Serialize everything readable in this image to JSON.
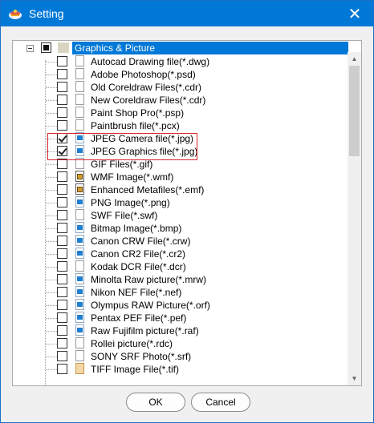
{
  "window": {
    "title": "Setting",
    "close_glyph": "✕"
  },
  "tree": {
    "root_label": "Graphics & Picture",
    "root_checked": "partial",
    "items": [
      {
        "label": "Autocad Drawing file(*.dwg)",
        "checked": false,
        "icon": "document-icon"
      },
      {
        "label": "Adobe Photoshop(*.psd)",
        "checked": false,
        "icon": "document-icon"
      },
      {
        "label": "Old Coreldraw Files(*.cdr)",
        "checked": false,
        "icon": "document-icon"
      },
      {
        "label": "New Coreldraw Files(*.cdr)",
        "checked": false,
        "icon": "document-icon"
      },
      {
        "label": "Paint Shop Pro(*.psp)",
        "checked": false,
        "icon": "document-icon"
      },
      {
        "label": "Paintbrush file(*.pcx)",
        "checked": false,
        "icon": "document-icon"
      },
      {
        "label": "JPEG Camera file(*.jpg)",
        "checked": true,
        "icon": "image-file-icon"
      },
      {
        "label": "JPEG Graphics file(*.jpg)",
        "checked": true,
        "icon": "image-file-icon"
      },
      {
        "label": "GIF Files(*.gif)",
        "checked": false,
        "icon": "document-icon"
      },
      {
        "label": "WMF Image(*.wmf)",
        "checked": false,
        "icon": "metafile-icon"
      },
      {
        "label": "Enhanced Metafiles(*.emf)",
        "checked": false,
        "icon": "metafile-icon"
      },
      {
        "label": "PNG Image(*.png)",
        "checked": false,
        "icon": "image-file-icon"
      },
      {
        "label": "SWF File(*.swf)",
        "checked": false,
        "icon": "document-icon"
      },
      {
        "label": "Bitmap Image(*.bmp)",
        "checked": false,
        "icon": "image-file-icon"
      },
      {
        "label": "Canon CRW File(*.crw)",
        "checked": false,
        "icon": "image-file-icon"
      },
      {
        "label": "Canon CR2 File(*.cr2)",
        "checked": false,
        "icon": "image-file-icon"
      },
      {
        "label": "Kodak DCR File(*.dcr)",
        "checked": false,
        "icon": "document-icon"
      },
      {
        "label": "Minolta Raw picture(*.mrw)",
        "checked": false,
        "icon": "image-file-icon"
      },
      {
        "label": "Nikon NEF File(*.nef)",
        "checked": false,
        "icon": "image-file-icon"
      },
      {
        "label": "Olympus RAW Picture(*.orf)",
        "checked": false,
        "icon": "image-file-icon"
      },
      {
        "label": "Pentax PEF File(*.pef)",
        "checked": false,
        "icon": "image-file-icon"
      },
      {
        "label": "Raw Fujifilm picture(*.raf)",
        "checked": false,
        "icon": "image-file-icon"
      },
      {
        "label": "Rollei picture(*.rdc)",
        "checked": false,
        "icon": "document-icon"
      },
      {
        "label": "SONY SRF Photo(*.srf)",
        "checked": false,
        "icon": "document-icon"
      },
      {
        "label": "TIFF Image File(*.tif)",
        "checked": false,
        "icon": "tiff-file-icon"
      }
    ]
  },
  "buttons": {
    "ok": "OK",
    "cancel": "Cancel"
  },
  "colors": {
    "accent": "#0078d7",
    "highlight_box": "#d9262e"
  }
}
